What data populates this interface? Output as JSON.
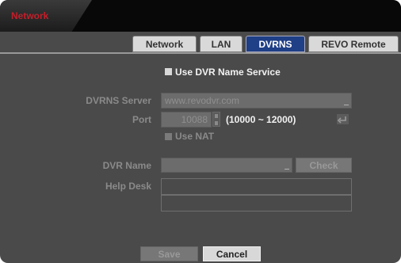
{
  "window": {
    "title": "Network"
  },
  "tabs": [
    {
      "label": "Network",
      "active": false
    },
    {
      "label": "LAN",
      "active": false
    },
    {
      "label": "DVRNS",
      "active": true
    },
    {
      "label": "REVO Remote",
      "active": false
    }
  ],
  "use_dvrns": {
    "label": "Use DVR Name Service",
    "checked": true
  },
  "dvrns_server": {
    "label": "DVRNS Server",
    "value": "www.revodvr.com"
  },
  "port": {
    "label": "Port",
    "value": "10088",
    "range": "(10000 ~ 12000)"
  },
  "use_nat": {
    "label": "Use NAT"
  },
  "dvr_name": {
    "label": "DVR Name",
    "value": "",
    "check_label": "Check"
  },
  "help_desk": {
    "label": "Help Desk",
    "line1": "",
    "line2": ""
  },
  "footer": {
    "save_label": "Save",
    "cancel_label": "Cancel"
  },
  "colors": {
    "accent": "#1f3f86",
    "title_red": "#c41e2a",
    "panel": "#4a4a4a"
  },
  "icons": {
    "reset": "reset-arrow-icon"
  }
}
